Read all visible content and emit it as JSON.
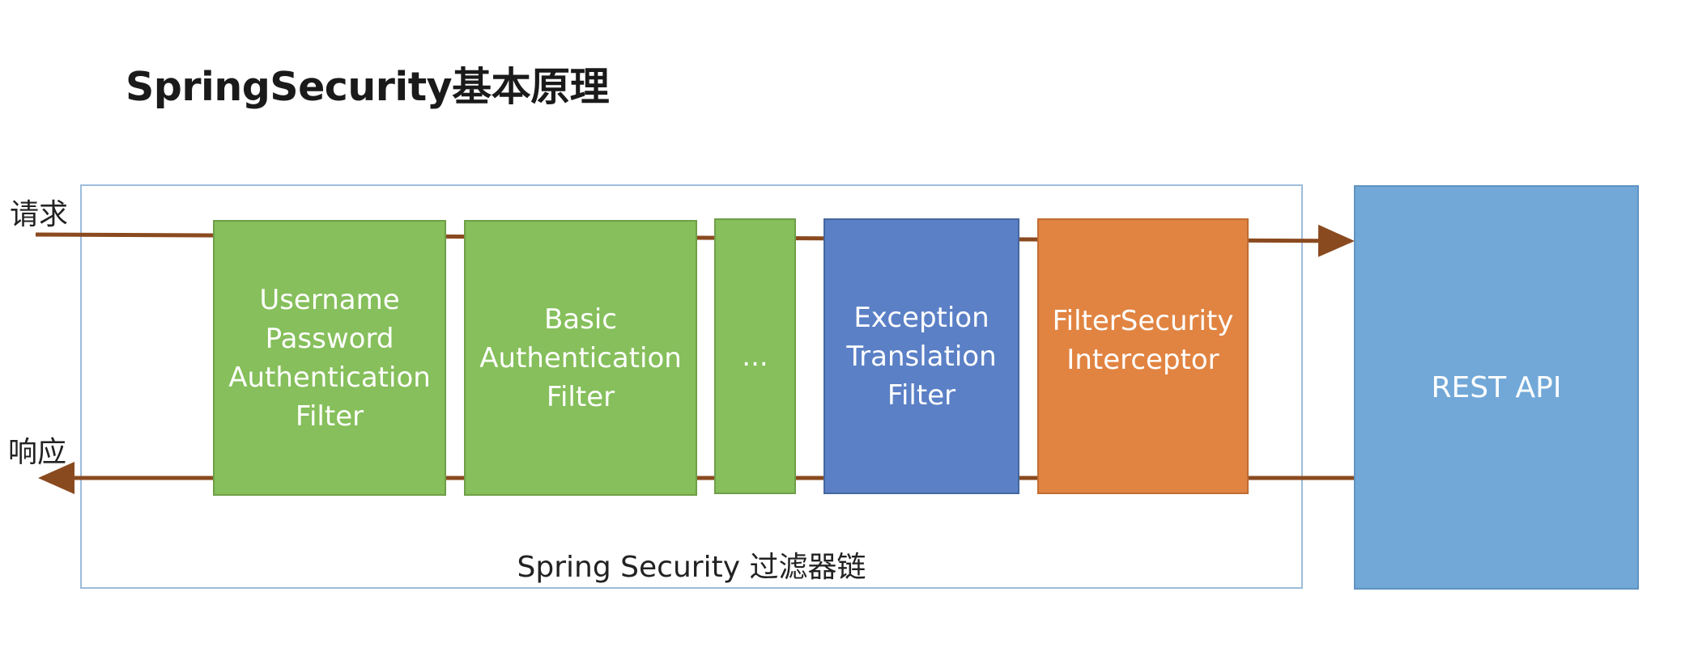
{
  "title": "SpringSecurity基本原理",
  "labels": {
    "request": "请求",
    "response": "响应",
    "chain": "Spring Security 过滤器链"
  },
  "filters": [
    {
      "label": "Username\nPassword\nAuthentication\nFilter",
      "color": "#86bf5b",
      "border": "#6f9f48"
    },
    {
      "label": "Basic\nAuthentication\nFilter",
      "color": "#86bf5b",
      "border": "#6f9f48"
    },
    {
      "label": "...",
      "color": "#86bf5b",
      "border": "#6f9f48"
    },
    {
      "label": "Exception\nTranslation\nFilter",
      "color": "#5b80c6",
      "border": "#46679f"
    },
    {
      "label": "FilterSecurity\nInterceptor",
      "color": "#e18442",
      "border": "#c06d33"
    }
  ],
  "rest": {
    "label": "REST API",
    "color": "#72a8d8",
    "border": "#5f93c2"
  },
  "colors": {
    "arrow": "#8a4a1f",
    "chain_border": "#9dbcdc"
  }
}
